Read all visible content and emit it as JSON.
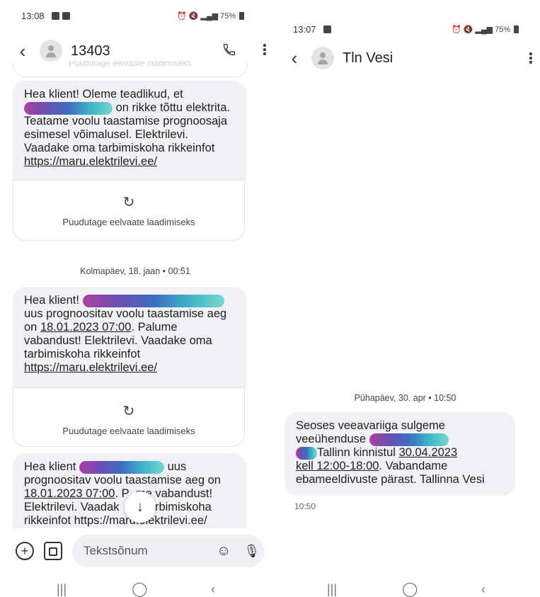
{
  "left": {
    "status": {
      "time": "13:08",
      "battery": "75%"
    },
    "header": {
      "title": "13403"
    },
    "ghost_text": "Puudutage eelvaate laadimiseks",
    "messages": [
      {
        "part1": "Hea klient! Oleme teadlikud, et",
        "part2": "on rikke tõttu",
        "part3": "elektrita. Teatame voolu taastamise prognoosaja esimesel võimalusel. Elektrilevi. Vaadake oma tarbimiskoha rikkeinfot ",
        "link": "https://maru.elektrilevi.ee/",
        "preview": "Puudutage eelvaate laadimiseks"
      },
      {
        "date": "Kolmapäev, 18. jaan • 00:51",
        "part1": "Hea klient!",
        "part2": "uus prognoositav voolu taastamise aeg on ",
        "date_link": "18.01.2023 07:00",
        "part3": ". Palume vabandust! Elektrilevi. Vaadake oma tarbimiskoha rikkeinfot ",
        "link": "https://maru.elektrilevi.ee/",
        "preview": "Puudutage eelvaate laadimiseks"
      },
      {
        "part1": "Hea klient",
        "part2": "uus",
        "part3": "prognoositav voolu taastamise aeg on",
        "date_link": "18.01.2023 07:00",
        "part4": ". P",
        "part5": "me vabandust!",
        "part6": "Elektrilevi. Vaadak",
        "part7": "a tarbimiskoha",
        "part8": "rikkeinfot https://maru.elektrilevi.ee/"
      }
    ],
    "composer": {
      "placeholder": "Tekstsõnum"
    }
  },
  "right": {
    "status": {
      "time": "13:07",
      "battery": "75%"
    },
    "header": {
      "title": "Tln Vesi"
    },
    "message": {
      "date": "Pühapäev, 30. apr • 10:50",
      "part1": "Seoses veeavariiga sulgeme veeühenduse",
      "part2": "Tallinn kinnistul ",
      "link1": "30.04.2023",
      "link2": "kell 12:00-18:00",
      "part3": ". Vabandame ebameeldivuste pärast. Tallinna Vesi",
      "time": "10:50"
    }
  },
  "icons": {
    "back": "back-arrow-icon",
    "call": "phone-icon",
    "menu": "kebab-menu-icon",
    "reload": "refresh-icon",
    "scroll": "arrow-down-icon",
    "add": "plus-circle-icon",
    "gallery": "gallery-icon",
    "emoji": "emoji-icon",
    "mic": "mic-icon"
  }
}
